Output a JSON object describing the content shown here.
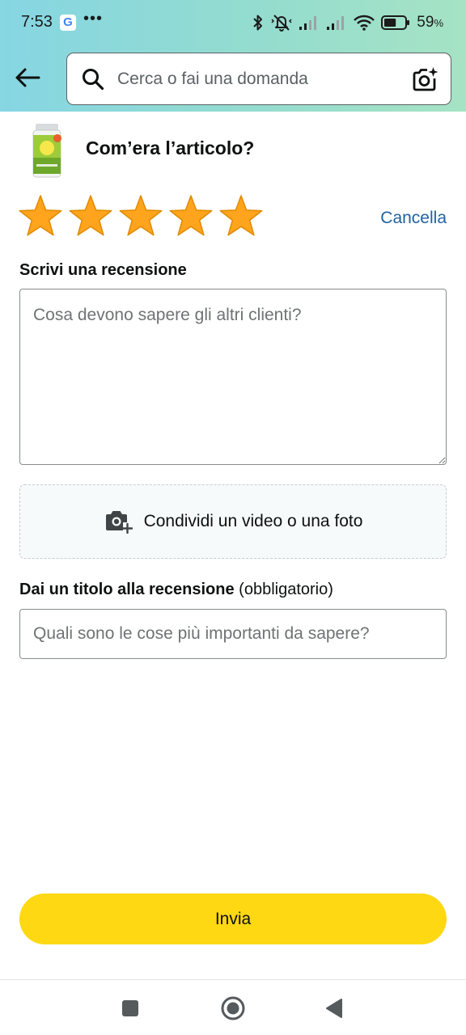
{
  "status_bar": {
    "time": "7:53",
    "google_badge": "G",
    "more_dots": "•••",
    "battery_percent": "59",
    "battery_unit": "%",
    "battery_level": 0.59,
    "icons": [
      "bluetooth-icon",
      "muted-vibrate-icon",
      "signal-icon",
      "signal-icon",
      "wifi-icon",
      "battery-icon"
    ]
  },
  "header": {
    "back_icon": "arrow-left-icon",
    "search": {
      "placeholder": "Cerca o fai una domanda",
      "value": "",
      "icon": "search-icon",
      "camera_icon": "camera-sparkle-icon"
    }
  },
  "review": {
    "question": "Com’era l’articolo?",
    "rating": 5,
    "rating_max": 5,
    "star_color": "#ffa41c",
    "cancel_label": "Cancella",
    "write_label": "Scrivi una recensione",
    "text_placeholder": "Cosa devono sapere gli altri clienti?",
    "text_value": "",
    "media_label": "Condividi un video o una foto",
    "media_icon": "camera-add-icon",
    "title_label_bold": "Dai un titolo alla recensione",
    "title_label_suffix": " (obbligatorio)",
    "title_placeholder": "Quali sono le cose più importanti da sapere?",
    "title_value": "",
    "submit_label": "Invia",
    "submit_color": "#ffd814"
  },
  "nav_bar": {
    "buttons": [
      "recents-icon",
      "home-icon",
      "back-triangle-icon"
    ]
  },
  "colors": {
    "header_gradient_start": "#86d6e3",
    "header_gradient_end": "#a6e3c4",
    "link": "#2162a1"
  }
}
